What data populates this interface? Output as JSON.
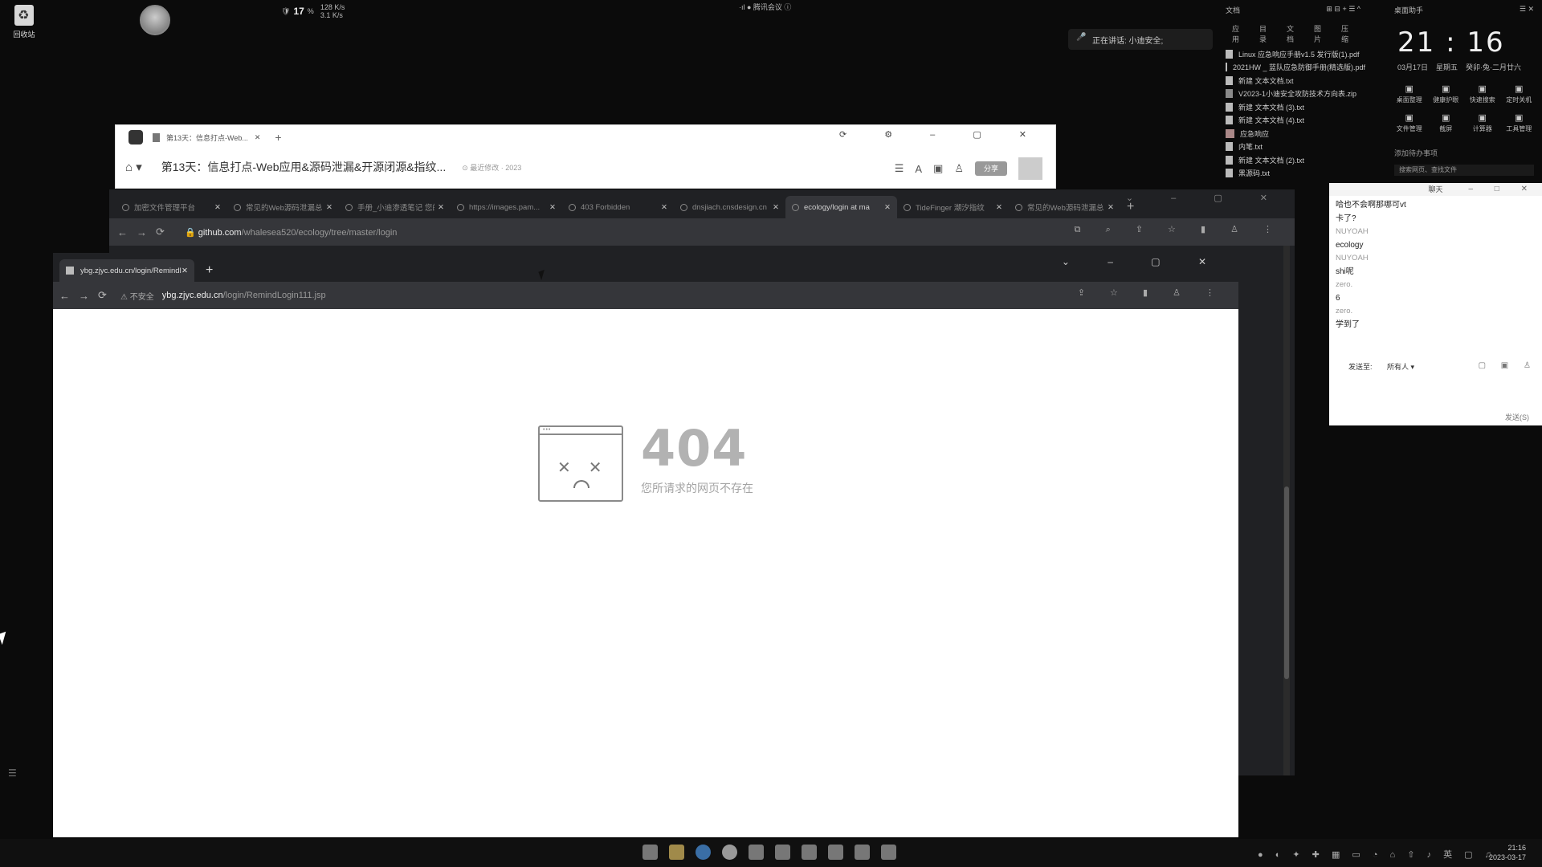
{
  "desktop": {
    "recycle_label": "回收站",
    "netmon": {
      "cpu": "17",
      "cpu_unit": "%",
      "up": "128 K/s",
      "down": "3.1 K/s"
    },
    "meeting_label": "·ıl ● 腾讯会议 ⓘ",
    "speaking_label": "正在讲话: 小迪安全;"
  },
  "files_widget": {
    "title": "文档",
    "tabs": [
      "应用",
      "目录",
      "文档",
      "图片",
      "压缩"
    ],
    "items": [
      {
        "name": "Linux 应急响应手册v1.5 发行版(1).pdf",
        "kind": "pdf"
      },
      {
        "name": "2021HW _ 蓝队应急防御手册(精选版).pdf",
        "kind": "pdf"
      },
      {
        "name": "新建 文本文档.txt",
        "kind": "txt"
      },
      {
        "name": "V2023-1小迪安全攻防技术方向表.zip",
        "kind": "zip"
      },
      {
        "name": "新建 文本文档 (3).txt",
        "kind": "txt"
      },
      {
        "name": "新建 文本文档 (4).txt",
        "kind": "txt"
      },
      {
        "name": "应急响应",
        "kind": "folder"
      },
      {
        "name": "内笔.txt",
        "kind": "txt"
      },
      {
        "name": "新建 文本文档 (2).txt",
        "kind": "txt"
      },
      {
        "name": "黑源码.txt",
        "kind": "txt"
      }
    ]
  },
  "clock_widget": {
    "title": "桌面助手",
    "time": "21 : 16",
    "date": "03月17日",
    "weekday": "星期五",
    "lunar": "癸卯·兔·二月廿六",
    "tools": [
      "桌面整理",
      "健康护眼",
      "快速搜索",
      "定时关机",
      "文件管理",
      "截屏",
      "计算器",
      "工具管理"
    ],
    "todo": "添加待办事项",
    "search_placeholder": "搜索网页、查找文件"
  },
  "chat": {
    "title": "聊天",
    "messages": [
      {
        "type": "text",
        "text": "哈也不会啊那哪可vt"
      },
      {
        "type": "text",
        "text": "卡了?"
      },
      {
        "type": "name",
        "text": "NUYOAH"
      },
      {
        "type": "text",
        "text": "ecology"
      },
      {
        "type": "name",
        "text": "NUYOAH"
      },
      {
        "type": "text",
        "text": "shi呢"
      },
      {
        "type": "name",
        "text": "zero."
      },
      {
        "type": "text",
        "text": "6"
      },
      {
        "type": "name",
        "text": "zero."
      },
      {
        "type": "text",
        "text": "学到了"
      }
    ],
    "send_to_label": "发送至:",
    "send_to_value": "所有人 ▾",
    "send_button": "发送(S)"
  },
  "win1": {
    "tab_title": "第13天：信息打点-Web...",
    "page_title": "第13天：信息打点-Web应用&源码泄漏&开源闭源&指纹...",
    "page_meta": "⊙ 最近修改 · 2023",
    "pill_label": "分享"
  },
  "win2": {
    "tabs": [
      "加密文件管理平台",
      "常见的Web源码泄漏总",
      "手册_小迪渗透笔记 您的",
      "https://images.pam...",
      "403 Forbidden",
      "dnsjiach.cnsdesign.cn",
      "ecology/login at ma",
      "TideFinger 潮汐指纹",
      "常见的Web源码泄漏总"
    ],
    "url_host": "github.com",
    "url_path": "/whalesea520/ecology/tree/master/login"
  },
  "win3": {
    "tab_title": "ybg.zjyc.edu.cn/login/Remindl",
    "insecure_label": "不安全",
    "url_host": "ybg.zjyc.edu.cn",
    "url_path": "/login/RemindLogin111.jsp",
    "error_code": "404",
    "error_message": "您所请求的网页不存在"
  },
  "taskbar": {
    "time": "21:16",
    "date": "2023-03-17"
  }
}
